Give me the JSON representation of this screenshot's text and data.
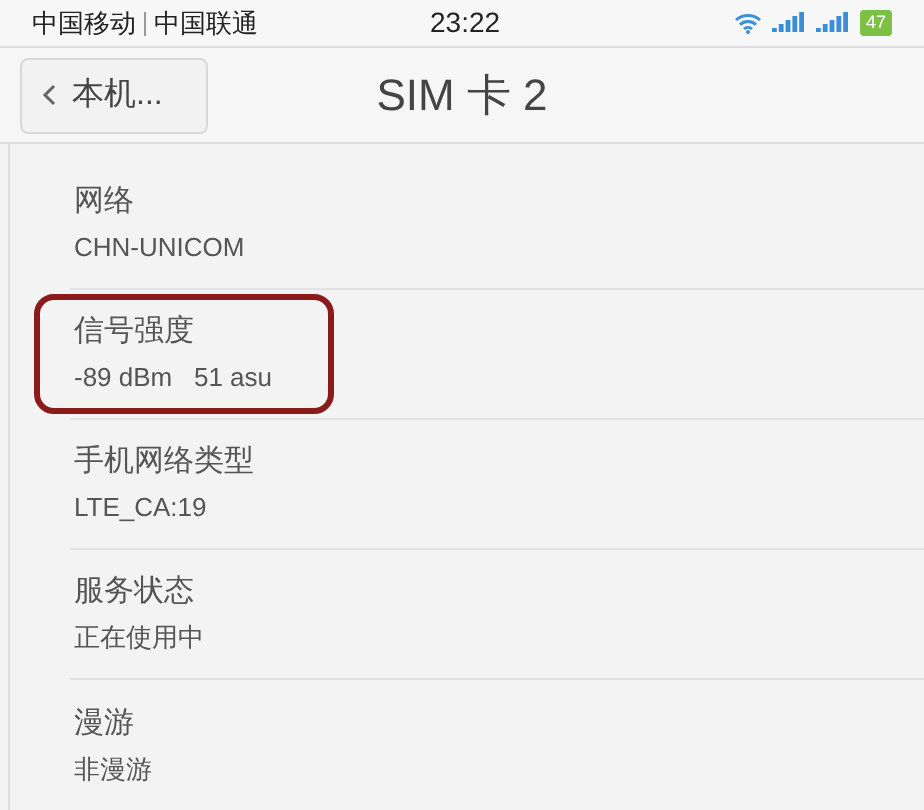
{
  "status_bar": {
    "carriers": [
      "中国移动",
      "中国联通"
    ],
    "time": "23:22",
    "battery": "47"
  },
  "header": {
    "back": "本机...",
    "title": "SIM 卡 2"
  },
  "items": [
    {
      "label": "网络",
      "value": "CHN-UNICOM",
      "highlighted": false
    },
    {
      "label": "信号强度",
      "value": "-89 dBm   51 asu",
      "highlighted": true
    },
    {
      "label": "手机网络类型",
      "value": "LTE_CA:19",
      "highlighted": false
    },
    {
      "label": "服务状态",
      "value": "正在使用中",
      "highlighted": false
    },
    {
      "label": "漫游",
      "value": "非漫游",
      "highlighted": false
    }
  ]
}
